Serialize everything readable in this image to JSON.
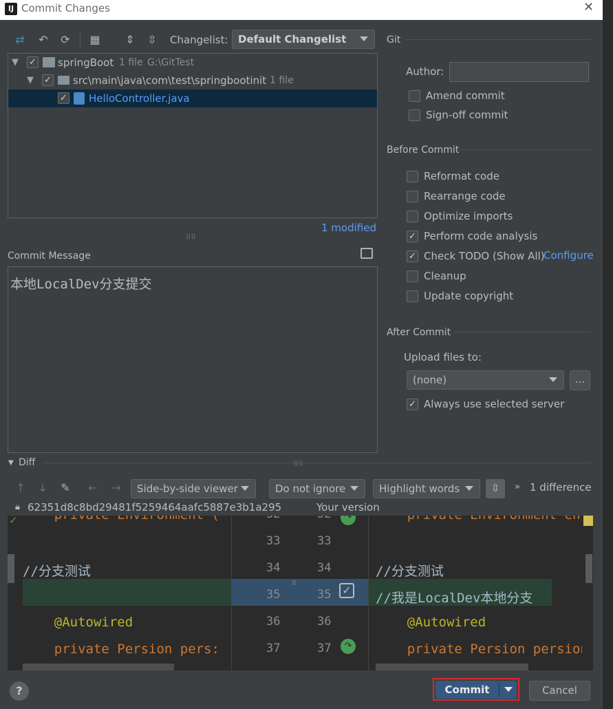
{
  "window": {
    "title": "Commit Changes",
    "logo": "IJ"
  },
  "toolbar": {
    "changelist_label": "Changelist:",
    "changelist_value": "Default Changelist"
  },
  "tree": {
    "root": {
      "name": "springBoot",
      "count": "1 file",
      "path": "G:\\GitTest"
    },
    "folder": {
      "name": "src\\main\\java\\com\\test\\springbootinit",
      "count": "1 file"
    },
    "file": {
      "name": "HelloController.java"
    },
    "status": "1 modified"
  },
  "commit_message": {
    "label": "Commit Message",
    "text": "本地LocalDev分支提交"
  },
  "git": {
    "section_title": "Git",
    "author_label": "Author:",
    "author_value": "",
    "amend_label": "Amend commit",
    "signoff_label": "Sign-off commit"
  },
  "before_commit": {
    "title": "Before Commit",
    "items": [
      {
        "label": "Reformat code",
        "checked": false
      },
      {
        "label": "Rearrange code",
        "checked": false
      },
      {
        "label": "Optimize imports",
        "checked": false
      },
      {
        "label": "Perform code analysis",
        "checked": true
      },
      {
        "label": "Check TODO (Show All)",
        "checked": true
      },
      {
        "label": "Cleanup",
        "checked": false
      },
      {
        "label": "Update copyright",
        "checked": false
      }
    ],
    "configure_link": "Configure"
  },
  "after_commit": {
    "title": "After Commit",
    "upload_label": "Upload files to:",
    "upload_value": "(none)",
    "more_button": "...",
    "always_label": "Always use selected server"
  },
  "diff": {
    "title": "Diff",
    "viewer": "Side-by-side viewer",
    "ignore": "Do not ignore",
    "highlight": "Highlight words",
    "count": "1 difference",
    "left_header": "62351d8c8bd29481f5259464aafc5887e3b1a295",
    "right_header": "Your version",
    "left_lines": [
      "    private Environment (",
      "",
      "//分支测试",
      "",
      "    @Autowired",
      "    private Persion pers:"
    ],
    "right_lines": [
      "    private Environment en",
      "",
      "//分支测试",
      "//我是LocalDev本地分支",
      "    @Autowired",
      "    private Persion persion"
    ],
    "numbers_left": [
      "32",
      "33",
      "34",
      "35",
      "36",
      "37"
    ],
    "numbers_right": [
      "32",
      "33",
      "34",
      "35",
      "36",
      "37"
    ]
  },
  "footer": {
    "help": "?",
    "commit": "Commit",
    "cancel": "Cancel"
  },
  "colors": {
    "accent": "#4a88c7",
    "selection": "#0d293e",
    "link": "#589df6",
    "highlight_border": "#e0282a"
  }
}
